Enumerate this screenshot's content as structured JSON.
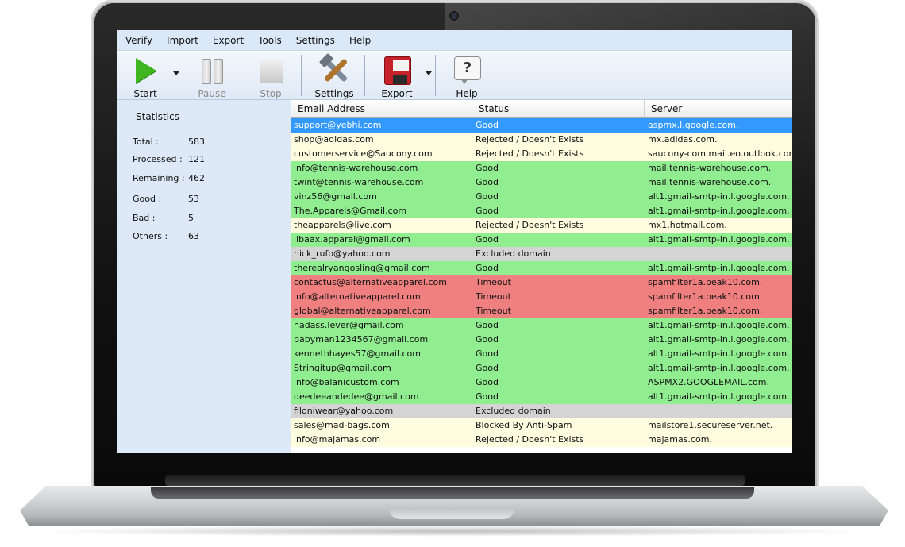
{
  "menu": [
    "Verify",
    "Import",
    "Export",
    "Tools",
    "Settings",
    "Help"
  ],
  "toolbar": {
    "start": "Start",
    "pause": "Pause",
    "stop": "Stop",
    "settings": "Settings",
    "export": "Export",
    "help": "Help",
    "help_glyph": "?"
  },
  "stats": {
    "title": "Statistics",
    "total_label": "Total :",
    "total": "583",
    "processed_label": "Processed :",
    "processed": "121",
    "remaining_label": "Remaining :",
    "remaining": "462",
    "good_label": "Good :",
    "good": "53",
    "bad_label": "Bad :",
    "bad": "5",
    "others_label": "Others :",
    "others": "63"
  },
  "grid": {
    "columns": [
      "Email Address",
      "Status",
      "Server"
    ],
    "rows": [
      {
        "email": "support@yebhi.com",
        "status": "Good",
        "server": "aspmx.l.google.com.",
        "kind": "selected"
      },
      {
        "email": "shop@adidas.com",
        "status": "Rejected / Doesn't Exists",
        "server": "mx.adidas.com.",
        "kind": "rejected"
      },
      {
        "email": "customerservice@Saucony.com",
        "status": "Rejected / Doesn't Exists",
        "server": "saucony-com.mail.eo.outlook.com",
        "kind": "rejected"
      },
      {
        "email": "info@tennis-warehouse.com",
        "status": "Good",
        "server": "mail.tennis-warehouse.com.",
        "kind": "good"
      },
      {
        "email": "twint@tennis-warehouse.com",
        "status": "Good",
        "server": "mail.tennis-warehouse.com.",
        "kind": "good"
      },
      {
        "email": "vinz56@gmail.com",
        "status": "Good",
        "server": "alt1.gmail-smtp-in.l.google.com.",
        "kind": "good"
      },
      {
        "email": "The.Apparels@Gmail.com",
        "status": "Good",
        "server": "alt1.gmail-smtp-in.l.google.com.",
        "kind": "good"
      },
      {
        "email": "theapparels@live.com",
        "status": "Rejected / Doesn't Exists",
        "server": "mx1.hotmail.com.",
        "kind": "rejected"
      },
      {
        "email": "libaax.apparel@gmail.com",
        "status": "Good",
        "server": "alt1.gmail-smtp-in.l.google.com.",
        "kind": "good"
      },
      {
        "email": "nick_rufo@yahoo.com",
        "status": "Excluded domain",
        "server": "",
        "kind": "excluded"
      },
      {
        "email": "therealryangosling@gmail.com",
        "status": "Good",
        "server": "alt1.gmail-smtp-in.l.google.com.",
        "kind": "good"
      },
      {
        "email": "contactus@alternativeapparel.com",
        "status": "Timeout",
        "server": "spamfilter1a.peak10.com.",
        "kind": "timeout"
      },
      {
        "email": "info@alternativeapparel.com",
        "status": "Timeout",
        "server": "spamfilter1a.peak10.com.",
        "kind": "timeout"
      },
      {
        "email": "global@alternativeapparel.com",
        "status": "Timeout",
        "server": "spamfilter1a.peak10.com.",
        "kind": "timeout"
      },
      {
        "email": "hadass.lever@gmail.com",
        "status": "Good",
        "server": "alt1.gmail-smtp-in.l.google.com.",
        "kind": "good"
      },
      {
        "email": "babyman1234567@gmail.com",
        "status": "Good",
        "server": "alt1.gmail-smtp-in.l.google.com.",
        "kind": "good"
      },
      {
        "email": "kennethhayes57@gmail.com",
        "status": "Good",
        "server": "alt1.gmail-smtp-in.l.google.com.",
        "kind": "good"
      },
      {
        "email": "Stringitup@gmail.com",
        "status": "Good",
        "server": "alt1.gmail-smtp-in.l.google.com.",
        "kind": "good"
      },
      {
        "email": "info@balanicustom.com",
        "status": "Good",
        "server": "ASPMX2.GOOGLEMAIL.com.",
        "kind": "good"
      },
      {
        "email": "deedeeandedee@gmail.com",
        "status": "Good",
        "server": "alt1.gmail-smtp-in.l.google.com.",
        "kind": "good"
      },
      {
        "email": "filoniwear@yahoo.com",
        "status": "Excluded domain",
        "server": "",
        "kind": "excluded"
      },
      {
        "email": "sales@mad-bags.com",
        "status": "Blocked By Anti-Spam",
        "server": "mailstore1.secureserver.net.",
        "kind": "blocked"
      },
      {
        "email": "info@majamas.com",
        "status": "Rejected / Doesn't Exists",
        "server": "majamas.com.",
        "kind": "rejected"
      }
    ]
  }
}
